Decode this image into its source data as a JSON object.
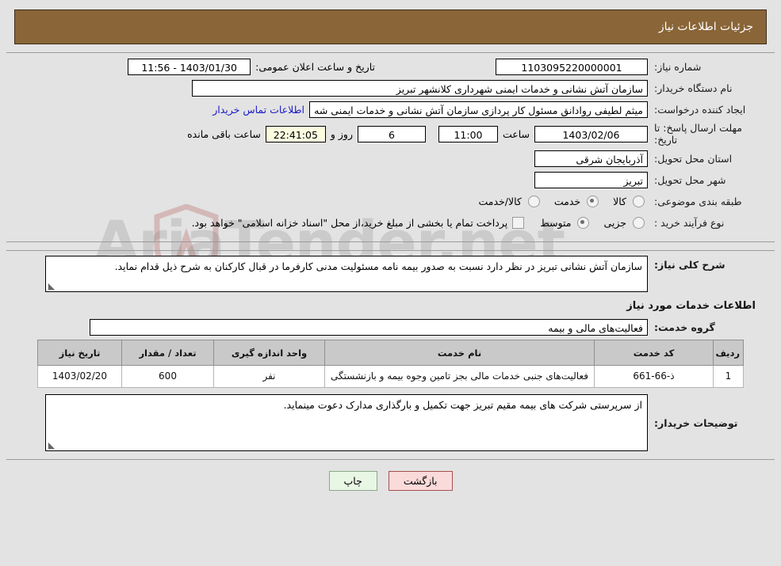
{
  "header": {
    "title": "جزئیات اطلاعات نیاز"
  },
  "watermark": {
    "text": "AriaTender.net"
  },
  "form": {
    "need_number_label": "شماره نیاز:",
    "need_number_value": "1103095220000001",
    "announce_datetime_label": "تاریخ و ساعت اعلان عمومی:",
    "announce_datetime_value": "1403/01/30 - 11:56",
    "buyer_org_label": "نام دستگاه خریدار:",
    "buyer_org_value": "سازمان آتش نشانی و خدمات ایمنی شهرداری کلانشهر تبریز",
    "creator_label": "ایجاد کننده درخواست:",
    "creator_value": "میثم لطیفی روادانق مسئول کار پردازی سازمان آتش نشانی و خدمات ایمنی شه",
    "contact_link": "اطلاعات تماس خریدار",
    "deadline_label": "مهلت ارسال پاسخ: تا تاریخ:",
    "deadline_date": "1403/02/06",
    "hour_label": "ساعت",
    "deadline_time": "11:00",
    "days_remaining": "6",
    "days_label": "روز و",
    "time_remaining": "22:41:05",
    "remaining_suffix": "ساعت باقی مانده",
    "province_label": "استان محل تحویل:",
    "province_value": "آذربایجان شرقی",
    "city_label": "شهر محل تحویل:",
    "city_value": "تبریز",
    "category_label": "طبقه بندی موضوعی:",
    "category_options": [
      {
        "label": "کالا",
        "selected": false
      },
      {
        "label": "خدمت",
        "selected": true
      },
      {
        "label": "کالا/خدمت",
        "selected": false
      }
    ],
    "process_label": "نوع فرآیند خرید :",
    "process_options": [
      {
        "label": "جزیی",
        "selected": false
      },
      {
        "label": "متوسط",
        "selected": true
      }
    ],
    "treasury_checkbox_checked": false,
    "treasury_note": "پرداخت تمام یا بخشی از مبلغ خرید،از محل \"اسناد خزانه اسلامی\" خواهد بود."
  },
  "description": {
    "label": "شرح کلی نیاز:",
    "value": "سازمان آتش نشانی تبریز در نظر دارد نسبت به صدور بیمه نامه مسئولیت مدنی کارفرما در قبال کارکنان به شرح ذیل قدام نماید."
  },
  "services_section": {
    "heading": "اطلاعات خدمات مورد نیاز",
    "group_label": "گروه خدمت:",
    "group_value": "فعالیت‌های مالی و بیمه"
  },
  "table": {
    "columns": [
      "ردیف",
      "کد خدمت",
      "نام خدمت",
      "واحد اندازه گیری",
      "تعداد / مقدار",
      "تاریخ نیاز"
    ],
    "rows": [
      {
        "row_no": "1",
        "service_code": "ذ-66-661",
        "service_name": "فعالیت‌های جنبی خدمات مالی بجز تامین وجوه بیمه و بازنشستگی",
        "unit": "نفر",
        "quantity": "600",
        "need_date": "1403/02/20"
      }
    ]
  },
  "buyer_notes": {
    "label": "توضیحات خریدار:",
    "value": "از سرپرستی شرکت های بیمه مقیم تبریز جهت تکمیل و بارگذاری مدارک دعوت مینماید."
  },
  "footer": {
    "print_label": "چاپ",
    "back_label": "بازگشت"
  }
}
